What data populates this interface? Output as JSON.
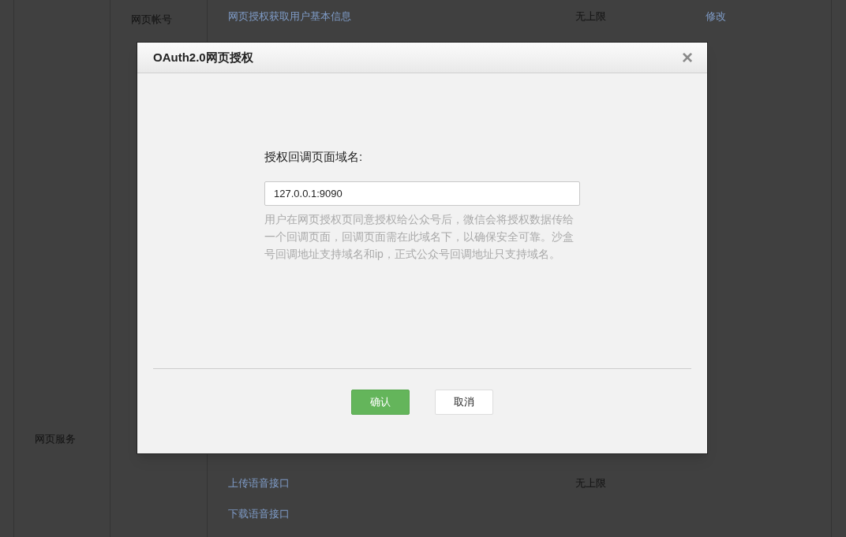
{
  "background_table": {
    "category": "网页服务",
    "subcategory": "网页帐号",
    "rows": [
      {
        "name": "网页授权获取用户基本信息",
        "limit": "无上限",
        "action": "修改"
      },
      {
        "name": "上传语音接口",
        "limit": "无上限"
      },
      {
        "name": "下载语音接口"
      }
    ]
  },
  "dialog": {
    "title": "OAuth2.0网页授权",
    "close": "×",
    "field_label": "授权回调页面域名:",
    "field_value": "127.0.0.1:9090",
    "help": "用户在网页授权页同意授权给公众号后，微信会将授权数据传给一个回调页面，回调页面需在此域名下，以确保安全可靠。沙盒号回调地址支持域名和ip，正式公众号回调地址只支持域名。",
    "buttons": [
      {
        "label": "确认",
        "kind": "primary"
      },
      {
        "label": "取消",
        "kind": "secondary"
      }
    ]
  }
}
